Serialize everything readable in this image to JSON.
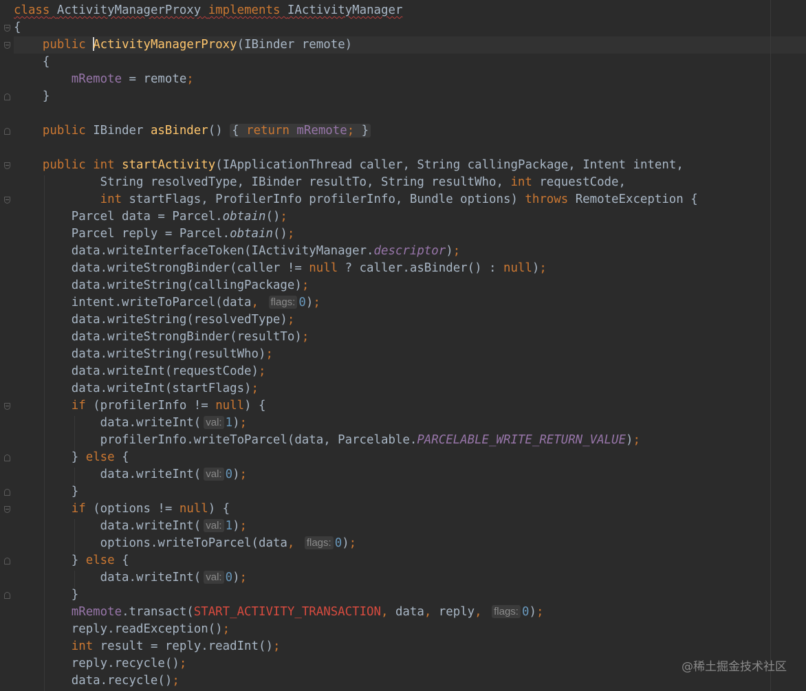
{
  "editor": {
    "class_decl": {
      "kw_class": "class",
      "name": "ActivityManagerProxy",
      "kw_implements": "implements",
      "iface": "IActivityManager"
    },
    "brace_open": "{",
    "ctor": {
      "kw": "public",
      "name": "ActivityManagerProxy",
      "params": "(IBinder remote)"
    },
    "ctor_open": "{",
    "ctor_body": {
      "field": "mRemote",
      "rest": " = remote",
      "semi": ";"
    },
    "ctor_close": "}",
    "as_binder": {
      "kw": "public",
      "type": " IBinder ",
      "name": "asBinder",
      "parens": "()",
      "fold_open": "{ ",
      "ret_kw": "return",
      "field": " mRemote",
      "semi": ";",
      "fold_close": " }"
    },
    "start_activity": {
      "kw": "public",
      "kw_int": "int",
      "name": "startActivity",
      "params1": "(IApplicationThread caller, String callingPackage, Intent intent,",
      "params2a": "String resolvedType, IBinder resultTo, String resultWho, ",
      "params2_int": "int",
      "params2b": " requestCode,",
      "params3_int": "int",
      "params3a": " startFlags, ProfilerInfo profilerInfo, Bundle options) ",
      "throws_kw": "throws",
      "params3b": " RemoteException {"
    },
    "lines": {
      "l12a": "Parcel data = Parcel.",
      "l12b": "obtain",
      "l12c": "()",
      "l12s": ";",
      "l13a": "Parcel reply = Parcel.",
      "l13b": "obtain",
      "l13c": "()",
      "l13s": ";",
      "l14a": "data.writeInterfaceToken(IActivityManager.",
      "l14b": "descriptor",
      "l14c": ")",
      "l14s": ";",
      "l15a": "data.writeStrongBinder(caller != ",
      "l15null1": "null",
      "l15b": " ? caller.asBinder() : ",
      "l15null2": "null",
      "l15c": ")",
      "l15s": ";",
      "l16a": "data.writeString(callingPackage)",
      "l16s": ";",
      "l17a": "intent.writeToParcel(data",
      "l17comma": ",",
      "l17hint": "flags:",
      "l17num": "0",
      "l17c": ")",
      "l17s": ";",
      "l18a": "data.writeString(resolvedType)",
      "l18s": ";",
      "l19a": "data.writeStrongBinder(resultTo)",
      "l19s": ";",
      "l20a": "data.writeString(resultWho)",
      "l20s": ";",
      "l21a": "data.writeInt(requestCode)",
      "l21s": ";",
      "l22a": "data.writeInt(startFlags)",
      "l22s": ";",
      "l23kw": "if",
      "l23a": " (profilerInfo != ",
      "l23null": "null",
      "l23b": ") {",
      "l24a": "data.writeInt(",
      "l24hint": "val:",
      "l24num": "1",
      "l24c": ")",
      "l24s": ";",
      "l25a": "profilerInfo.writeToParcel(data, Parcelable.",
      "l25const": "PARCELABLE_WRITE_RETURN_VALUE",
      "l25c": ")",
      "l25s": ";",
      "l26a": "} ",
      "l26kw": "else",
      "l26b": " {",
      "l27a": "data.writeInt(",
      "l27hint": "val:",
      "l27num": "0",
      "l27c": ")",
      "l27s": ";",
      "l28a": "}",
      "l29kw": "if",
      "l29a": " (options != ",
      "l29null": "null",
      "l29b": ") {",
      "l30a": "data.writeInt(",
      "l30hint": "val:",
      "l30num": "1",
      "l30c": ")",
      "l30s": ";",
      "l31a": "options.writeToParcel(data",
      "l31comma": ",",
      "l31hint": "flags:",
      "l31num": "0",
      "l31c": ")",
      "l31s": ";",
      "l32a": "} ",
      "l32kw": "else",
      "l32b": " {",
      "l33a": "data.writeInt(",
      "l33hint": "val:",
      "l33num": "0",
      "l33c": ")",
      "l33s": ";",
      "l34a": "}",
      "l35field": "mRemote",
      "l35a": ".transact(",
      "l35const": "START_ACTIVITY_TRANSACTION",
      "l35comma1": ",",
      "l35b": " data",
      "l35comma2": ",",
      "l35c": " reply",
      "l35comma3": ",",
      "l35hint": "flags:",
      "l35num": "0",
      "l35d": ")",
      "l35s": ";",
      "l36a": "reply.readException()",
      "l36s": ";",
      "l37kw": "int",
      "l37a": " result = reply.readInt()",
      "l37s": ";",
      "l38a": "reply.recycle()",
      "l38s": ";",
      "l39a": "data.recycle()",
      "l39s": ";"
    }
  },
  "watermark": "@稀土掘金技术社区",
  "colors": {
    "background": "#2b2b2b",
    "keyword": "#cc7832",
    "method_decl": "#ffc66d",
    "field": "#9876aa",
    "number": "#6897bb",
    "constant": "#d84b3f",
    "text": "#a9b7c6"
  }
}
